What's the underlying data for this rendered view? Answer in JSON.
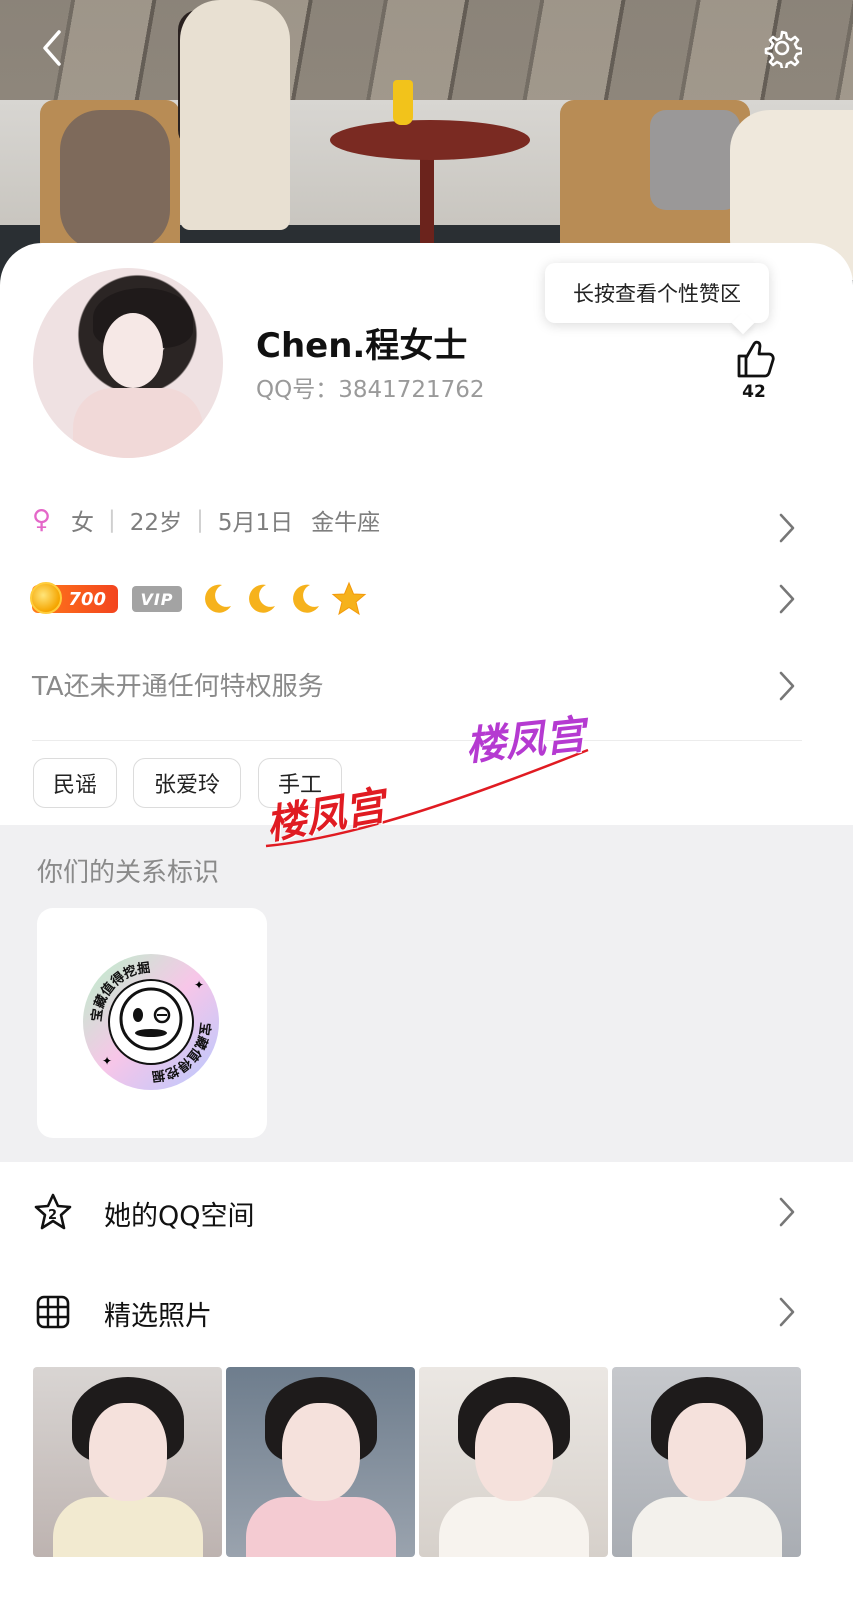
{
  "header": {
    "back_icon": "chevron-left-icon",
    "settings_icon": "gear-icon"
  },
  "profile": {
    "nickname": "Chen.程女士",
    "qq_label": "QQ号：",
    "qq_number": "3841721762",
    "like_tooltip": "长按查看个性赞区",
    "like_count": "42",
    "gender_icon": "♀",
    "gender": "女",
    "age": "22岁",
    "birthday": "5月1日",
    "zodiac": "金牛座"
  },
  "badges": {
    "level": "700",
    "vip": "VIP",
    "moon_icon": "moon-icon",
    "star_icon": "star-icon",
    "moons": 3,
    "stars": 1
  },
  "privilege_text": "TA还未开通任何特权服务",
  "tags": [
    "民谣",
    "张爱玲",
    "手工"
  ],
  "watermarks": [
    "楼凤宫",
    "楼凤宫"
  ],
  "relation": {
    "title": "你们的关系标识",
    "badge_text": "宝藏值得挖掘"
  },
  "menu": {
    "qzone": "她的QQ空间",
    "photos": "精选照片"
  },
  "colors": {
    "accent_red": "#e01b22",
    "accent_purple": "#b53ad1",
    "level_orange": "#f3441e",
    "female_pink": "#e467c8"
  }
}
